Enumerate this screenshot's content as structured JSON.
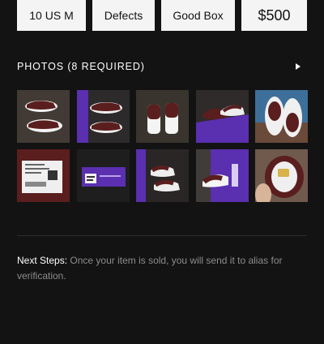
{
  "attributes": {
    "size": "10 US M",
    "condition": "Defects",
    "packaging": "Good Box",
    "price": "$500"
  },
  "photos": {
    "title": "PHOTOS (8 REQUIRED)",
    "items": [
      "sneakers-pair-top-view",
      "sneakers-on-box-side",
      "sneakers-heels-floor",
      "sneakers-on-box-angle",
      "sneakers-soles",
      "size-tag-label",
      "box-label",
      "sneakers-in-box",
      "box-side-logo",
      "insole-closeup"
    ]
  },
  "next_steps": {
    "label": "Next Steps:",
    "text": "Once your item is sold, you will send it to alias for verification."
  },
  "colors": {
    "background": "#131313",
    "chip": "#f4f4f4",
    "muted_text": "#8c8c8c",
    "shoe_burgundy": "#5a1e1e",
    "box_purple": "#5a2fb0"
  }
}
